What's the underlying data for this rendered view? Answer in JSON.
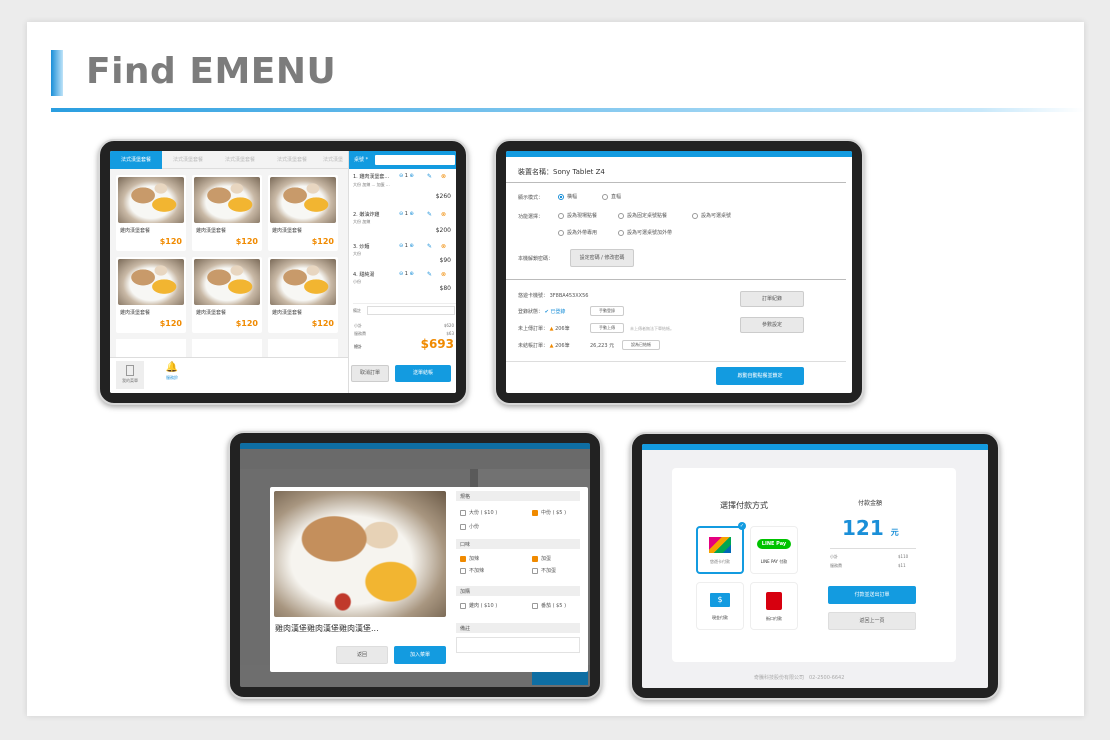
{
  "page": {
    "title": "Find EMENU"
  },
  "colors": {
    "accent": "#139be0",
    "price": "#f08a00",
    "title": "#7c7c7c"
  },
  "menu": {
    "tabs": [
      "法式漢堡套餐",
      "法式漢堡套餐",
      "法式漢堡套餐",
      "法式漢堡套餐",
      "法式漢堡"
    ],
    "items": [
      {
        "name": "雞肉漢堡套餐",
        "price": "$120"
      },
      {
        "name": "雞肉漢堡套餐",
        "price": "$120"
      },
      {
        "name": "雞肉漢堡套餐",
        "price": "$120"
      },
      {
        "name": "雞肉漢堡套餐",
        "price": "$120"
      },
      {
        "name": "雞肉漢堡套餐",
        "price": "$120"
      },
      {
        "name": "雞肉漢堡套餐",
        "price": "$120"
      }
    ],
    "table_label": "桌號 *",
    "order": [
      {
        "name": "1. 雞肉漢堡套...",
        "qty": "1",
        "price": "$260",
        "note": "大份  加辣 ...  加蛋 ..."
      },
      {
        "name": "2. 嫩油炸雞",
        "qty": "1",
        "price": "$200",
        "note": "大份 加辣"
      },
      {
        "name": "3. 炒麵",
        "qty": "1",
        "price": "$90",
        "note": "大份"
      },
      {
        "name": "4. 甜純湯",
        "qty": "1",
        "price": "$80",
        "note": "小份"
      }
    ],
    "note_label": "備註",
    "subtotal_label": "小計",
    "subtotal": "$620",
    "service_label": "服務費",
    "service": "$63",
    "total_label": "總計",
    "total": "$693",
    "nav": [
      "我的菜單",
      "服務鈴"
    ],
    "cancel_label": "取消訂單",
    "confirm_label": "送單結帳"
  },
  "settings": {
    "device_label": "裝置名稱：Sony Tablet Z4",
    "display_label": "顯示模式：",
    "display_opts": [
      "橫幅",
      "直幅"
    ],
    "func_label": "功能選擇：",
    "func_opts": [
      "設為現場點餐",
      "設為固定桌號點餐",
      "設為可選桌號",
      "設為外帶專用",
      "設為可選桌號加外帶"
    ],
    "pwd_label": "本機解鎖密碼：",
    "pwd_btn": "設定密碼 / 修改密碼",
    "card_label": "悠遊卡機號：",
    "card_value": "3F8BA453XX56",
    "login_label": "登錄狀態：",
    "login_value": "已登錄",
    "login_btn": "手動登錄",
    "upload_label": "未上傳訂單：",
    "upload_value": "206筆",
    "upload_btn": "手動上傳",
    "upload_hint": "未上傳者無法下單結帳。",
    "settle_label": "未結帳訂單：",
    "settle_value": "206筆",
    "settle_amount": "26,223 元",
    "settle_btn": "設為已結帳",
    "order_record": "訂單紀錄",
    "param_setting": "參數設定",
    "auto_btn": "啟動自動點餐並鎖定"
  },
  "detail": {
    "name": "雞肉漢堡雞肉漢堡雞肉漢堡...",
    "size_title": "規格",
    "size_opts": [
      "大份 ( $10 )",
      "中份 ( $5 )",
      "小份"
    ],
    "taste_title": "口味",
    "taste_opts": [
      "加辣",
      "加蛋",
      "不加辣",
      "不加蛋"
    ],
    "addon_title": "加購",
    "addon_opts": [
      "雞肉 ( $10 )",
      "番茄 ( $5 )"
    ],
    "note_title": "備註",
    "back_label": "返回",
    "add_label": "加入菜單"
  },
  "payment": {
    "title": "選擇付款方式",
    "methods": [
      "悠遊卡付款",
      "LINE PAY 付款",
      "現金付款",
      "街口付款"
    ],
    "linepay": "LINE Pay",
    "amount_title": "付款金額",
    "amount": "121",
    "amount_unit": "元",
    "subtotal_label": "小計",
    "subtotal": "$110",
    "service_label": "服務費",
    "service": "$11",
    "send_btn": "付款並送出訂單",
    "back_btn": "返回上一頁",
    "footer": "奇騰科技股份有限公司　02-2500-6642"
  }
}
